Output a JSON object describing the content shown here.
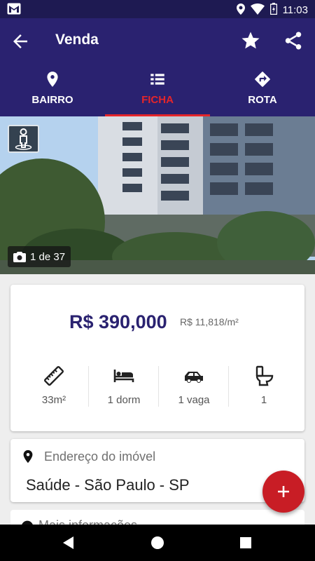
{
  "status_bar": {
    "time": "11:03",
    "icons": [
      "gmail-icon",
      "location-icon",
      "wifi-icon",
      "battery-charging-icon"
    ]
  },
  "app_bar": {
    "title": "Venda",
    "icons": [
      "back-arrow-icon",
      "star-icon",
      "share-icon"
    ]
  },
  "tabs": [
    {
      "label": "BAIRRO",
      "icon": "location-pin-icon",
      "active": false
    },
    {
      "label": "FICHA",
      "icon": "list-icon",
      "active": true
    },
    {
      "label": "ROTA",
      "icon": "directions-icon",
      "active": false
    }
  ],
  "gallery": {
    "counter": "1 de 37",
    "streetview_icon": "street-view-icon"
  },
  "listing": {
    "price": "R$ 390,000",
    "price_per_m2": "R$ 11,818/m²",
    "features": [
      {
        "icon": "ruler-icon",
        "label": "33m²"
      },
      {
        "icon": "bed-icon",
        "label": "1 dorm"
      },
      {
        "icon": "car-icon",
        "label": "1 vaga"
      },
      {
        "icon": "toilet-icon",
        "label": "1"
      }
    ]
  },
  "address": {
    "label": "Endereço do imóvel",
    "value": "Saúde - São Paulo - SP"
  },
  "more_info": {
    "label": "Mais informações"
  },
  "fab": {
    "label": "+"
  },
  "colors": {
    "primary": "#2a2270",
    "accent": "#e5252a",
    "fab": "#c81d25"
  }
}
